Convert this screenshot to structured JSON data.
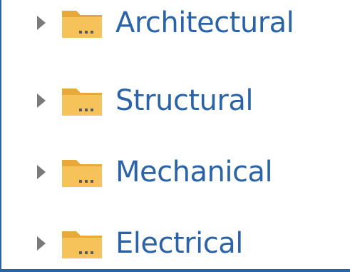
{
  "tree": {
    "items": [
      {
        "label": "Architectural",
        "icon": "folder-icon"
      },
      {
        "label": "Structural",
        "icon": "folder-icon"
      },
      {
        "label": "Mechanical",
        "icon": "folder-icon"
      },
      {
        "label": "Electrical",
        "icon": "folder-icon"
      }
    ]
  },
  "colors": {
    "label_text": "#2b63a8",
    "folder_body": "#f5c35a",
    "folder_tab": "#e8a93a",
    "expander_arrow": "#7a7a7a",
    "border_accent": "#2b63a8"
  }
}
